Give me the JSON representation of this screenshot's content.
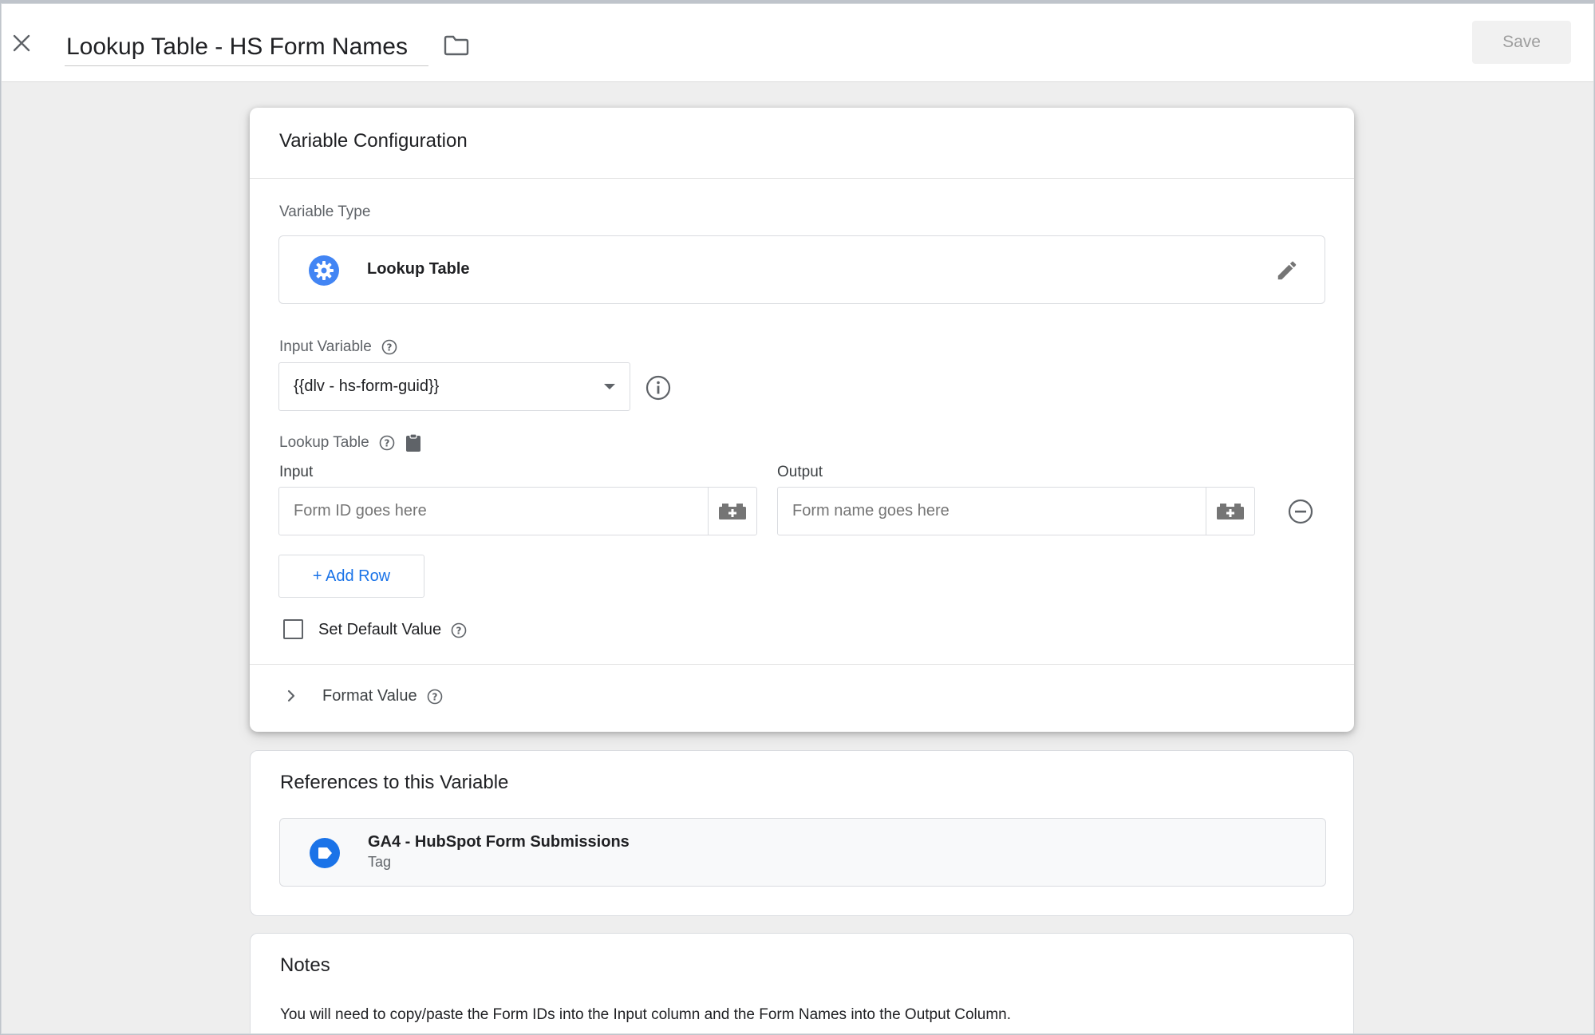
{
  "header": {
    "title": "Lookup Table - HS Form Names",
    "save_label": "Save"
  },
  "config": {
    "title": "Variable Configuration",
    "variable_type": {
      "label": "Variable Type",
      "name": "Lookup Table",
      "icon": "gear-icon",
      "icon_color": "#4285f4"
    },
    "input_variable": {
      "label": "Input Variable",
      "selected": "{{dlv - hs-form-guid}}"
    },
    "lookup_table": {
      "label": "Lookup Table",
      "input_header": "Input",
      "output_header": "Output",
      "rows": [
        {
          "input_placeholder": "Form ID goes here",
          "output_placeholder": "Form name goes here"
        }
      ],
      "add_row_label": "+ Add Row"
    },
    "set_default_label": "Set Default Value",
    "format_value_label": "Format Value"
  },
  "references": {
    "title": "References to this Variable",
    "items": [
      {
        "name": "GA4 - HubSpot Form Submissions",
        "type": "Tag",
        "icon": "tag-icon",
        "icon_color": "#1a73e8"
      }
    ]
  },
  "notes": {
    "title": "Notes",
    "text": "You will need to copy/paste the Form IDs into the Input column and the Form Names into the Output Column."
  },
  "colors": {
    "accent": "#1a73e8",
    "icon_grey": "#5f6368"
  }
}
